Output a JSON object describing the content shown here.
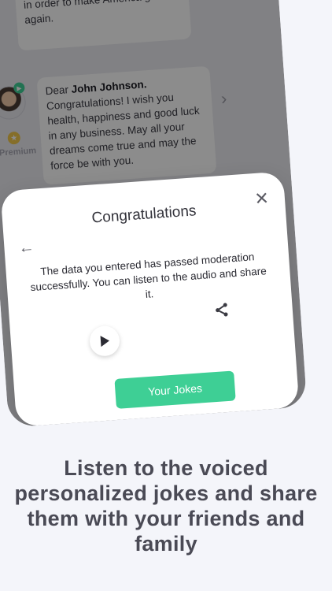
{
  "background": {
    "bubble_top_text": "work hard and comp... job tasks in order to make America great again.",
    "bubble_greeting_prefix": "Dear ",
    "bubble_greeting_name": "John Johnson.",
    "bubble_body": "Congratulations! I wish you health, happiness and good luck in any business. May all your dreams come true and may the force be with you.",
    "premium_label": "Premium"
  },
  "dialog": {
    "title": "Congratulations",
    "message": "The data you entered has passed moderation successfully. You can listen to the audio and share it.",
    "primary_button": "Your Jokes",
    "icons": {
      "close": "close-icon",
      "back": "back-arrow-icon",
      "play": "play-icon",
      "share": "share-icon"
    }
  },
  "caption": {
    "text": "Listen to the voiced personalized jokes and share them with your friends and family"
  },
  "colors": {
    "accent": "#3ecf95",
    "background": "#f4f5fa",
    "caption": "#4a4a55"
  }
}
